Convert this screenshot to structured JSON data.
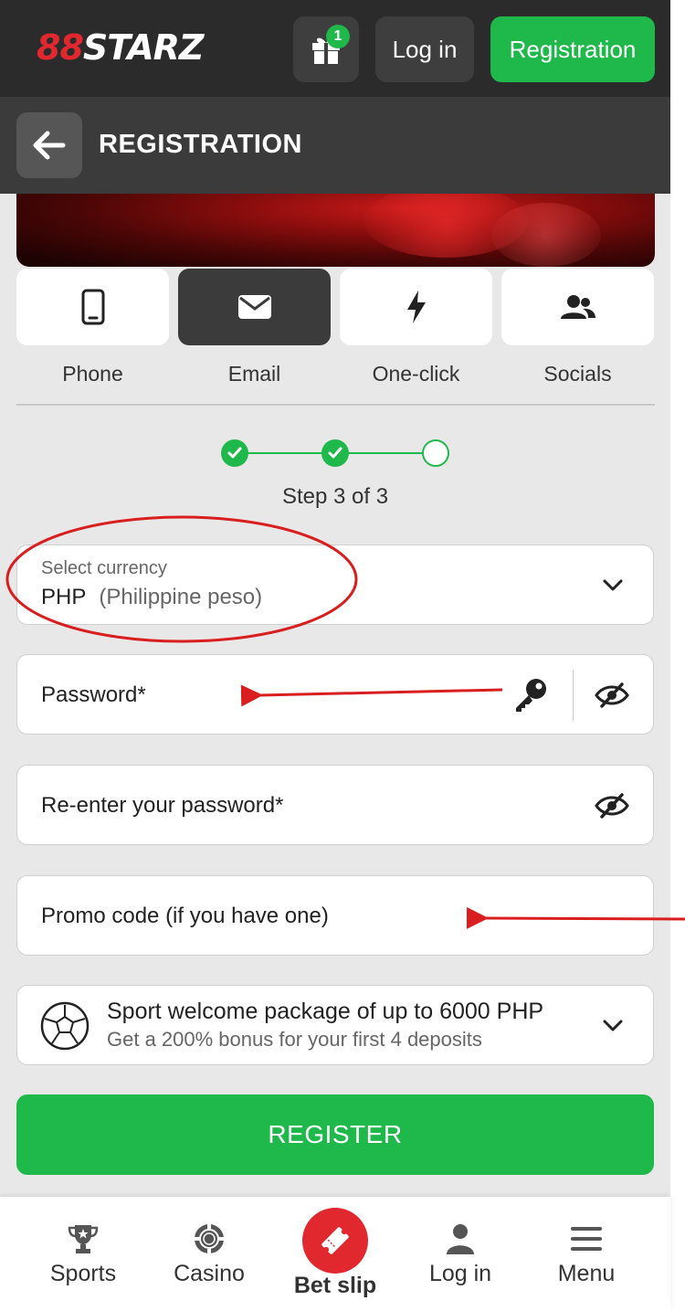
{
  "header": {
    "logo_prefix": "88",
    "logo_text": "STARZ",
    "gift_badge": "1",
    "login_label": "Log in",
    "registration_label": "Registration"
  },
  "titlebar": {
    "title": "REGISTRATION"
  },
  "methods": [
    {
      "label": "Phone",
      "icon": "phone-icon",
      "active": false
    },
    {
      "label": "Email",
      "icon": "email-icon",
      "active": true
    },
    {
      "label": "One-click",
      "icon": "lightning-icon",
      "active": false
    },
    {
      "label": "Socials",
      "icon": "people-icon",
      "active": false
    }
  ],
  "stepper": {
    "text": "Step 3 of 3",
    "current": 3,
    "total": 3
  },
  "currency": {
    "label": "Select currency",
    "code": "PHP",
    "name": "(Philippine peso)"
  },
  "password": {
    "placeholder": "Password*"
  },
  "confirm_password": {
    "placeholder": "Re-enter your password*"
  },
  "promo": {
    "placeholder": "Promo code (if you have one)"
  },
  "bonus": {
    "title": "Sport welcome package of up to 6000 PHP",
    "subtitle": "Get a 200% bonus for your first 4 deposits",
    "icon": "soccer-ball-icon"
  },
  "register_label": "REGISTER",
  "bottom_nav": {
    "sports": "Sports",
    "casino": "Casino",
    "bet_slip": "Bet slip",
    "login": "Log in",
    "menu": "Menu"
  },
  "colors": {
    "accent_green": "#1fb84a",
    "brand_red": "#e0282e",
    "header_dark": "#2b2b2b",
    "annotation_red": "#d81e1e"
  }
}
